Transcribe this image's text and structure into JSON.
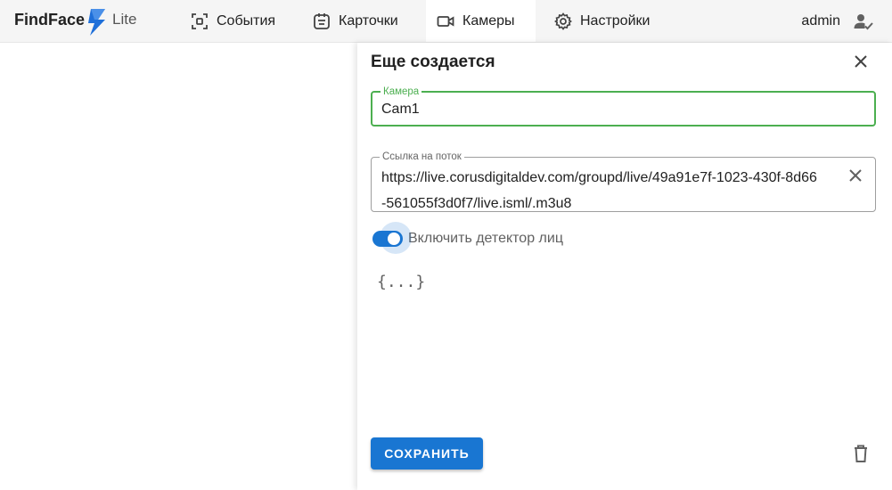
{
  "header": {
    "logo": {
      "name": "FindFace",
      "suffix": "Lite",
      "icon": "bolt-icon",
      "icon_color": "#1e6fd9"
    },
    "tabs": [
      {
        "id": "events",
        "label": "События",
        "icon": "face-scan-icon",
        "active": false
      },
      {
        "id": "cards",
        "label": "Карточки",
        "icon": "card-icon",
        "active": false
      },
      {
        "id": "cameras",
        "label": "Камеры",
        "icon": "videocam-icon",
        "active": true
      },
      {
        "id": "settings",
        "label": "Настройки",
        "icon": "gear-icon",
        "active": false
      }
    ],
    "user": {
      "name": "admin",
      "icon": "user-check-icon"
    }
  },
  "drawer": {
    "title": "Еще создается",
    "camera_field": {
      "label": "Камера",
      "value": "Cam1",
      "focused": true
    },
    "stream_field": {
      "label": "Ссылка на поток",
      "value": "https://live.corusdigitaldev.com/groupd/live/49a91e7f-1023-430f-8d66-561055f3d0f7/live.isml/.m3u8"
    },
    "face_detector": {
      "label": "Включить детектор лиц",
      "enabled": true
    },
    "json_button": "{...}",
    "save_label": "СОХРАНИТЬ"
  },
  "colors": {
    "accent": "#1976d2",
    "focus": "#4caf50",
    "topbar": "#f5f5f5"
  }
}
